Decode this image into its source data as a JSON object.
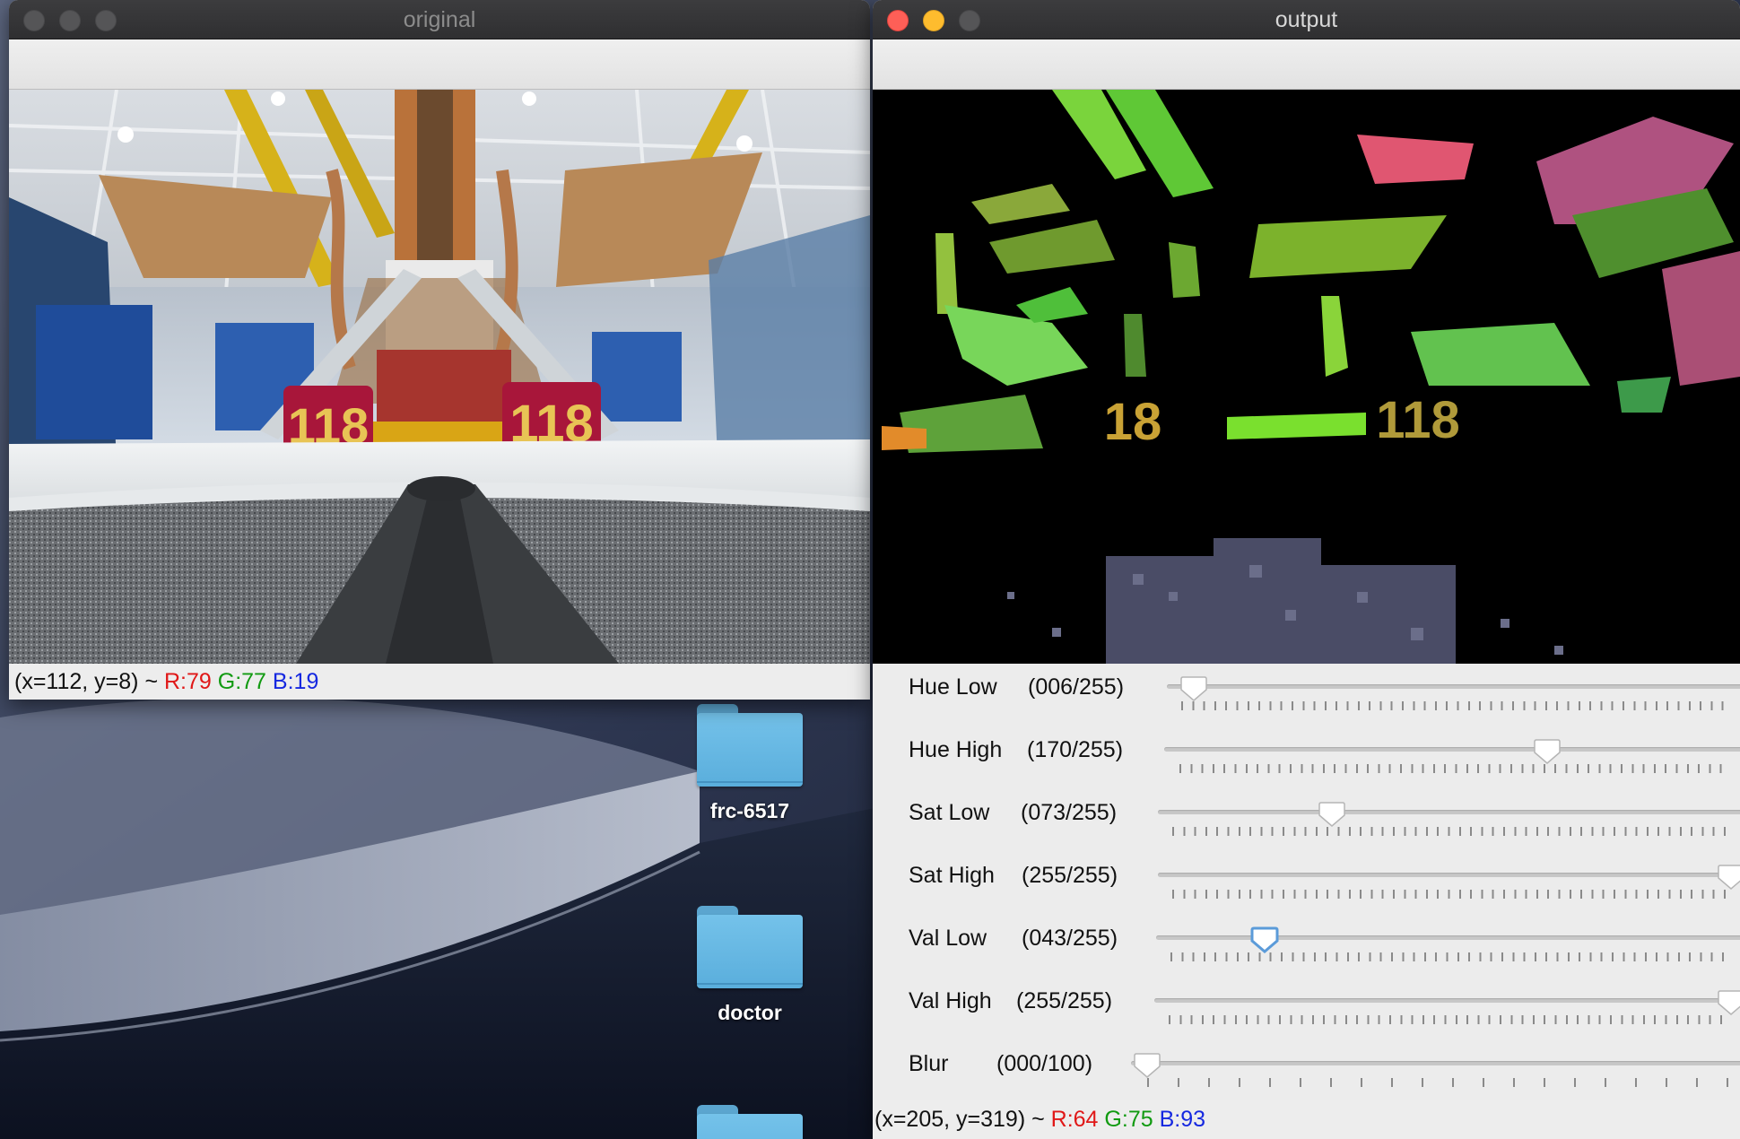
{
  "desktop": {
    "folders": [
      {
        "label": "frc-6517"
      },
      {
        "label": "doctor"
      },
      {
        "label": ""
      }
    ]
  },
  "original_window": {
    "title": "original",
    "active": false,
    "status": {
      "coords": "(x=112, y=8) ~ ",
      "r": "R:79",
      "g": "G:77",
      "b": "B:19"
    }
  },
  "output_window": {
    "title": "output",
    "active": true,
    "overlay_labels": [
      "18",
      "118"
    ],
    "trackbars": [
      {
        "name": "Hue Low",
        "value": "(006/255)",
        "level": 6,
        "max": 255,
        "focused": false
      },
      {
        "name": "Hue High",
        "value": "(170/255)",
        "level": 170,
        "max": 255,
        "focused": false
      },
      {
        "name": "Sat Low",
        "value": "(073/255)",
        "level": 73,
        "max": 255,
        "focused": false
      },
      {
        "name": "Sat High",
        "value": "(255/255)",
        "level": 255,
        "max": 255,
        "focused": false
      },
      {
        "name": "Val Low",
        "value": "(043/255)",
        "level": 43,
        "max": 255,
        "focused": true
      },
      {
        "name": "Val High",
        "value": "(255/255)",
        "level": 255,
        "max": 255,
        "focused": false
      },
      {
        "name": "Blur",
        "value": "(000/100)",
        "level": 0,
        "max": 100,
        "focused": false
      }
    ],
    "status": {
      "coords": "(x=205, y=319) ~ ",
      "r": "R:64",
      "g": "G:75",
      "b": "B:93"
    }
  },
  "camera_image": {
    "robot_number_left": "118",
    "robot_number_right": "118"
  },
  "colors": {
    "close": "#fe5f57",
    "minimize": "#febc2e",
    "status_red": "#e01818",
    "status_green": "#119a11",
    "status_blue": "#1528e0",
    "focused_knob": "#5b9bd9"
  }
}
